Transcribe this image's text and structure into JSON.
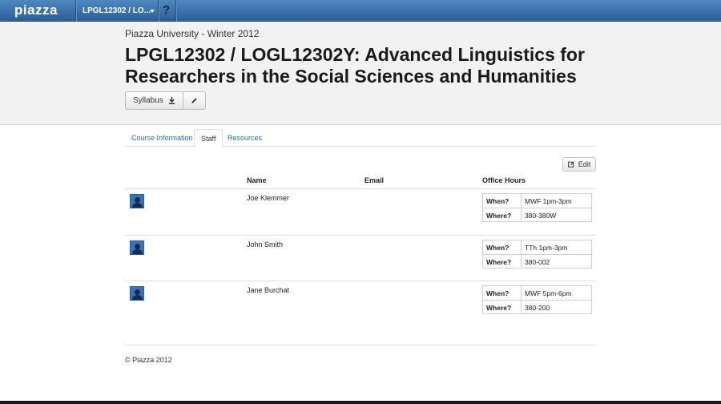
{
  "nav": {
    "logo": "piazza",
    "course_selector": "LPGL12302 / LO...",
    "help": "?"
  },
  "header": {
    "university": "Piazza University - Winter 2012",
    "title": "LPGL12302 / LOGL12302Y: Advanced Linguistics for Researchers in the Social Sciences and Humanities",
    "syllabus_label": "Syllabus"
  },
  "tabs": [
    {
      "label": "Course Information",
      "active": false
    },
    {
      "label": "Staff",
      "active": true
    },
    {
      "label": "Resources",
      "active": false
    }
  ],
  "edit_label": "Edit",
  "table": {
    "headers": {
      "name": "Name",
      "email": "Email",
      "office_hours": "Office Hours"
    },
    "when_label": "When?",
    "where_label": "Where?",
    "staff": [
      {
        "name": "Joe Klemmer",
        "email": "",
        "when": "MWF 1pm-3pm",
        "where": "380-380W"
      },
      {
        "name": "John Smith",
        "email": "",
        "when": "TTh 1pm-3pm",
        "where": "380-002"
      },
      {
        "name": "Jane Burchat",
        "email": "",
        "when": "MWF 5pm-6pm",
        "where": "380-200"
      }
    ]
  },
  "footer": "© Piazza 2012",
  "colors": {
    "nav": "#3a72ad",
    "link": "#2a6fb0",
    "avatar": "#3a74b5"
  }
}
